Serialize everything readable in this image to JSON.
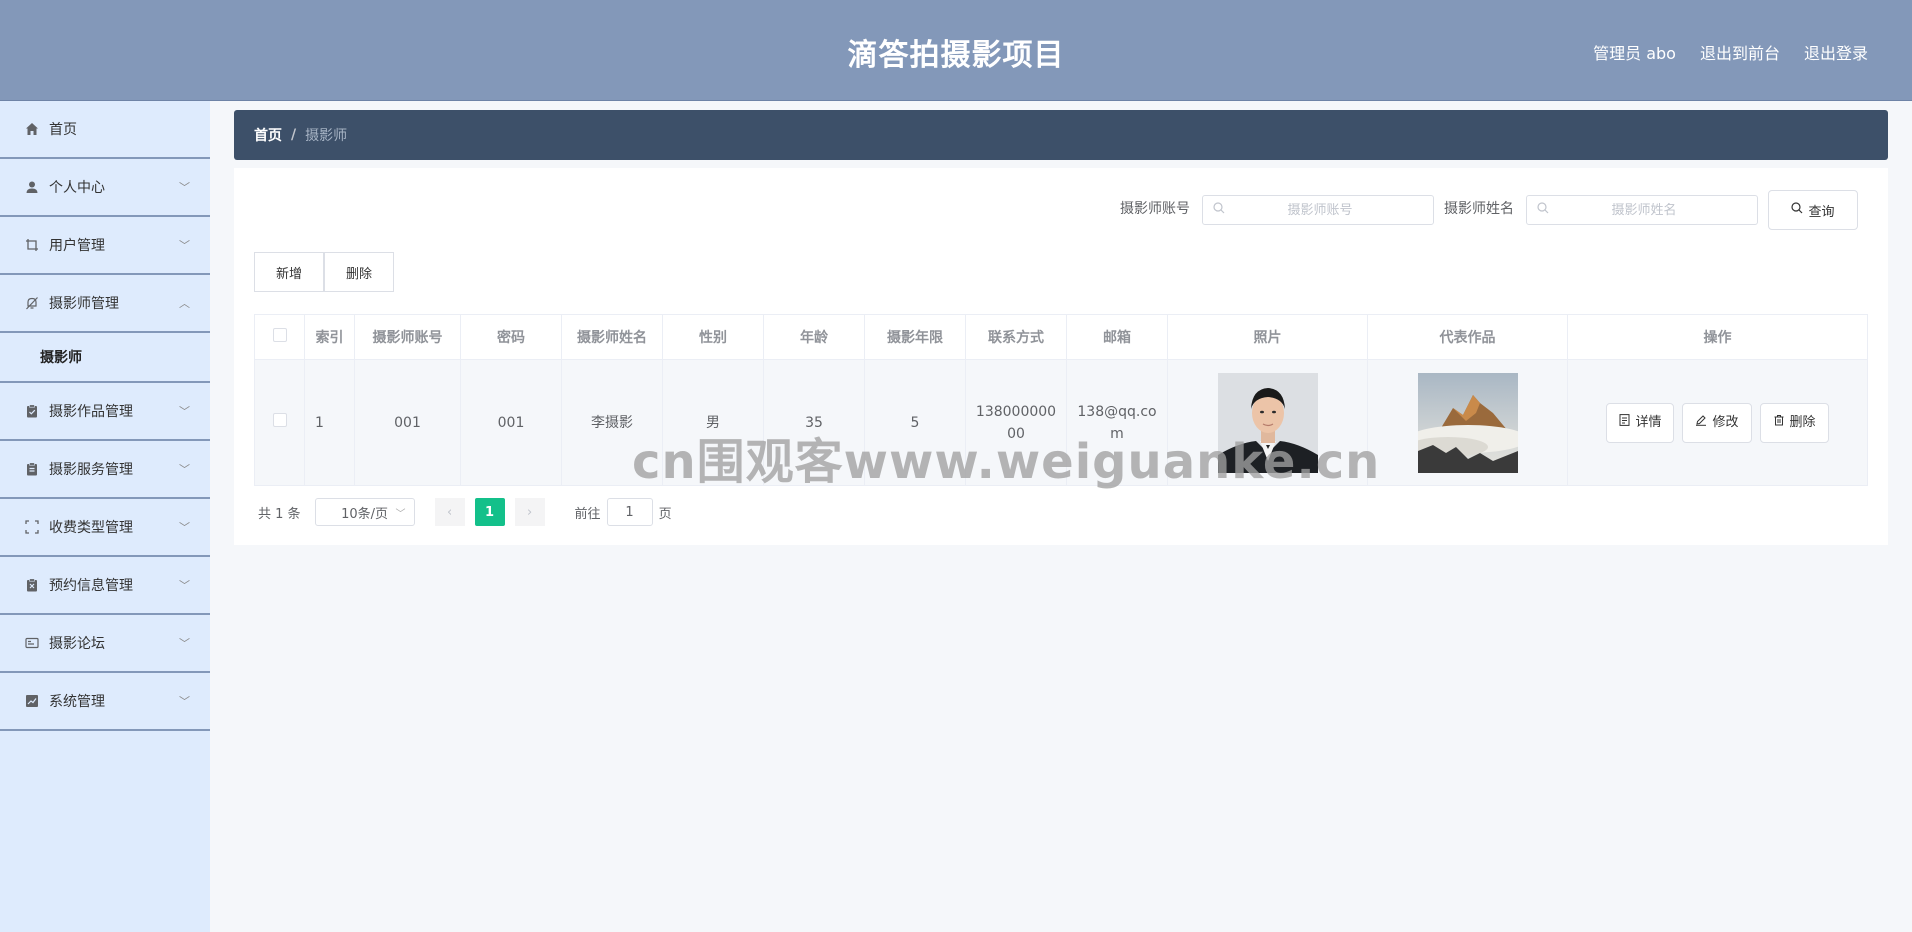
{
  "header": {
    "title": "滴答拍摄影项目",
    "user_label": "管理员 abo",
    "exit_front": "退出到前台",
    "logout": "退出登录"
  },
  "sidebar": {
    "items": [
      {
        "label": "首页",
        "icon": "home-icon"
      },
      {
        "label": "个人中心",
        "icon": "user-icon"
      },
      {
        "label": "用户管理",
        "icon": "crop-icon"
      },
      {
        "label": "摄影师管理",
        "icon": "bell-off-icon"
      },
      {
        "label": "摄影作品管理",
        "icon": "clipboard-icon"
      },
      {
        "label": "摄影服务管理",
        "icon": "clipboard-icon"
      },
      {
        "label": "收费类型管理",
        "icon": "fullscreen-icon"
      },
      {
        "label": "预约信息管理",
        "icon": "clipboard-x-icon"
      },
      {
        "label": "摄影论坛",
        "icon": "card-icon"
      },
      {
        "label": "系统管理",
        "icon": "chart-icon"
      }
    ],
    "sub_item": "摄影师"
  },
  "breadcrumb": {
    "home": "首页",
    "sep": "/",
    "current": "摄影师"
  },
  "search": {
    "account_label": "摄影师账号",
    "account_placeholder": "摄影师账号",
    "name_label": "摄影师姓名",
    "name_placeholder": "摄影师姓名",
    "query_label": "查询"
  },
  "actions": {
    "add": "新增",
    "delete": "删除"
  },
  "table": {
    "headers": [
      "索引",
      "摄影师账号",
      "密码",
      "摄影师姓名",
      "性别",
      "年龄",
      "摄影年限",
      "联系方式",
      "邮箱",
      "照片",
      "代表作品",
      "操作"
    ],
    "rows": [
      {
        "index": "1",
        "account": "001",
        "password": "001",
        "name": "李摄影",
        "gender": "男",
        "age": "35",
        "years": "5",
        "phone": "13800000000",
        "email": "138@qq.com"
      }
    ],
    "row_ops": {
      "detail": "详情",
      "edit": "修改",
      "delete": "删除"
    }
  },
  "pagination": {
    "total": "共 1 条",
    "page_size": "10条/页",
    "current_page": "1",
    "goto_prefix": "前往",
    "goto_value": "1",
    "goto_suffix": "页"
  },
  "watermark": "cn围观客www.weiguanke.cn",
  "colors": {
    "header_bg": "#8398b9",
    "sidebar_bg": "#deebfd",
    "breadcrumb_bg": "#3d5069",
    "page_active": "#13c08a"
  }
}
